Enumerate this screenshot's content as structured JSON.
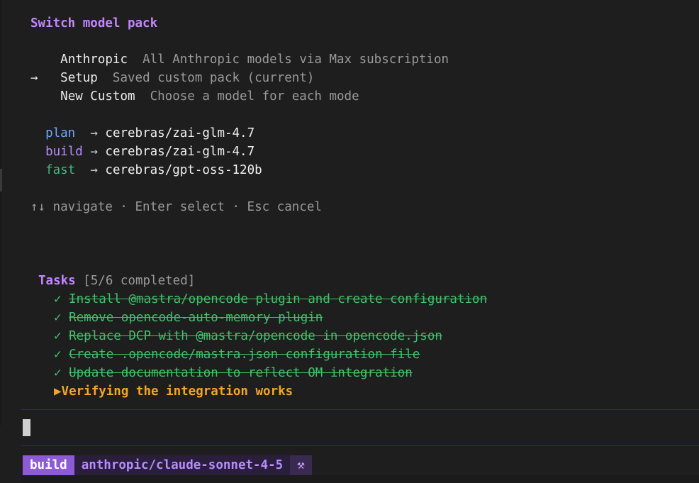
{
  "picker": {
    "title": "Switch model pack",
    "selected_arrow": "→",
    "packs": [
      {
        "name": "Anthropic",
        "description": "All Anthropic models via Max subscription",
        "selected": false
      },
      {
        "name": "Setup",
        "description": "Saved custom pack (current)",
        "selected": true
      },
      {
        "name": "New Custom",
        "description": "Choose a model for each mode",
        "selected": false
      }
    ],
    "modes": [
      {
        "mode": "plan",
        "arrow": "→",
        "model": "cerebras/zai-glm-4.7",
        "color": "#6ea8ff"
      },
      {
        "mode": "build",
        "arrow": "→",
        "model": "cerebras/zai-glm-4.7",
        "color": "#b98bff"
      },
      {
        "mode": "fast",
        "arrow": "→",
        "model": "cerebras/gpt-oss-120b",
        "color": "#3fb982"
      }
    ],
    "hint": "↑↓ navigate · Enter select · Esc cancel"
  },
  "tasks": {
    "title": "Tasks",
    "count": "[5/6 completed]",
    "done_icon": "✓",
    "active_icon": "▶",
    "items": [
      {
        "text": "Install @mastra/opencode plugin and create configuration",
        "status": "done"
      },
      {
        "text": "Remove opencode-auto-memory plugin",
        "status": "done"
      },
      {
        "text": "Replace DCP with @mastra/opencode in opencode.json",
        "status": "done"
      },
      {
        "text": "Create .opencode/mastra.json configuration file",
        "status": "done"
      },
      {
        "text": "Update documentation to reflect OM integration",
        "status": "done"
      },
      {
        "text": "Verifying the integration works",
        "status": "active"
      }
    ]
  },
  "statusbar": {
    "mode": "build",
    "model": "anthropic/claude-sonnet-4-5",
    "tool_icon": "⚒"
  },
  "colors": {
    "title": "#c386ff",
    "done": "#3ec36a",
    "active": "#f5a524",
    "mode_badge": "#8e5bd6",
    "model_badge": "#2a1e3d"
  }
}
